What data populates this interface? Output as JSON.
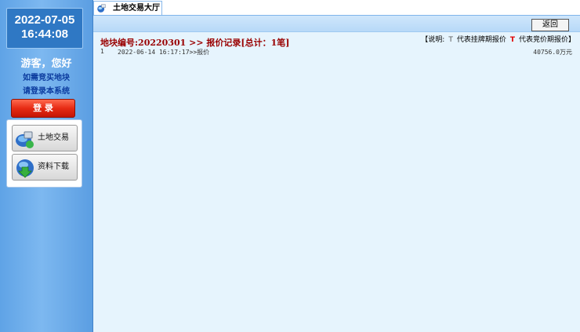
{
  "sidebar": {
    "date": "2022-07-05",
    "time": "16:44:08",
    "greeting": "游客，您好",
    "hint_line1": "如需竞买地块",
    "hint_line2": "请登录本系统",
    "login_label": "登 录",
    "menu": [
      {
        "label": "土地交易",
        "icon": "land-trade-icon"
      },
      {
        "label": "资料下载",
        "icon": "download-icon"
      }
    ]
  },
  "tabs": [
    {
      "label": "土地交易大厅",
      "icon": "globe-icon"
    }
  ],
  "toolbar": {
    "back_label": "返回"
  },
  "record": {
    "title": "地块编号:20220301 >> 报价记录[总计：1笔]",
    "legend": {
      "prefix": "【说明:",
      "listing_mark": "T",
      "listing_text": "代表挂牌期报价",
      "bidding_mark": "T",
      "bidding_text": "代表竞价期报价】"
    },
    "rows": [
      {
        "index": "1",
        "text": "2022-06-14 16:17:17>>报价",
        "amount": "40756.0万元"
      }
    ]
  },
  "colors": {
    "sidebar_blue": "#6aaee9",
    "content_bg": "#e6f4fd",
    "title_red": "#990000",
    "login_red": "#e62b14"
  }
}
